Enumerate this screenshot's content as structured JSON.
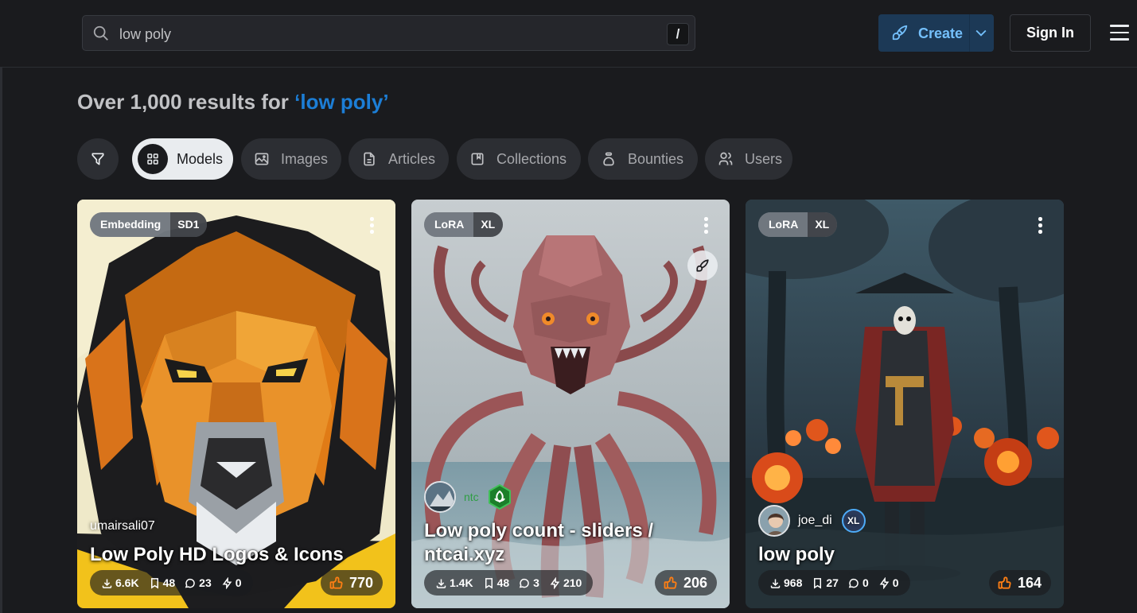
{
  "search": {
    "value": "low poly",
    "shortcut": "/"
  },
  "header": {
    "create_label": "Create",
    "signin_label": "Sign In"
  },
  "results": {
    "prefix": "Over 1,000 results for ",
    "query": "‘low poly’"
  },
  "tabs": [
    {
      "label": "Models",
      "icon": "grid-icon",
      "active": true
    },
    {
      "label": "Images",
      "icon": "photo-icon"
    },
    {
      "label": "Articles",
      "icon": "file-text-icon"
    },
    {
      "label": "Collections",
      "icon": "album-icon"
    },
    {
      "label": "Bounties",
      "icon": "moneybag-icon"
    },
    {
      "label": "Users",
      "icon": "users-icon"
    }
  ],
  "cards": [
    {
      "type": "Embedding",
      "base": "SD1",
      "creator": "umairsali07",
      "title": "Low Poly HD Logos & Icons",
      "downloads": "6.6K",
      "collects": "48",
      "comments": "23",
      "tips": "0",
      "likes": "770"
    },
    {
      "type": "LoRA",
      "base": "XL",
      "creator": "ntc",
      "title": "Low poly count - sliders / ntcai.xyz",
      "downloads": "1.4K",
      "collects": "48",
      "comments": "3",
      "tips": "210",
      "likes": "206"
    },
    {
      "type": "LoRA",
      "base": "XL",
      "creator": "joe_di",
      "creator_badge": "XL",
      "title": "low poly",
      "downloads": "968",
      "collects": "27",
      "comments": "0",
      "tips": "0",
      "likes": "164"
    }
  ],
  "colors": {
    "accent": "#1c7ed6",
    "create_bg": "#1c3956",
    "like": "#fd7e14"
  }
}
